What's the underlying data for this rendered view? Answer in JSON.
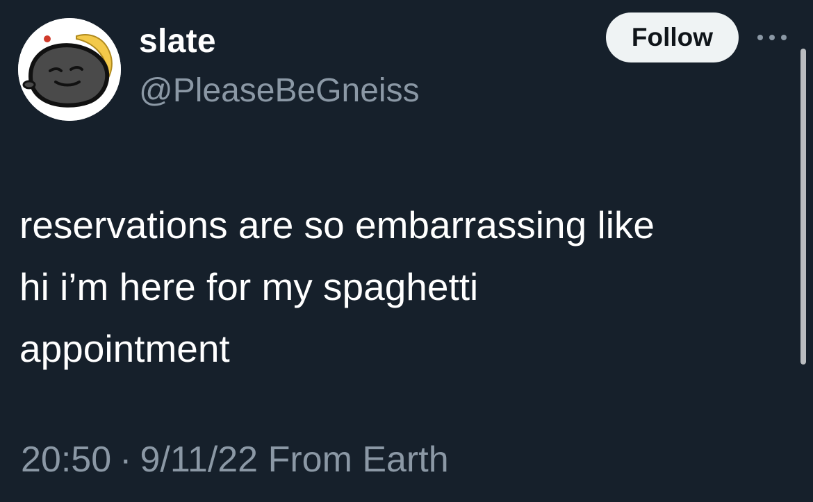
{
  "author": {
    "display_name": "slate",
    "handle": "@PleaseBeGneiss"
  },
  "actions": {
    "follow_label": "Follow",
    "more_icon": "more-horizontal-icon"
  },
  "tweet": {
    "text": "reservations are so embarrassing like\nhi i’m here for my spaghetti\nappointment",
    "time": "20:50",
    "separator": "·",
    "date": "9/11/22",
    "source": "From Earth"
  },
  "colors": {
    "background": "#16202b",
    "primary_text": "#ffffff",
    "secondary_text": "#8b98a5",
    "follow_button_bg": "#eff3f4",
    "follow_button_text": "#0f1419"
  }
}
